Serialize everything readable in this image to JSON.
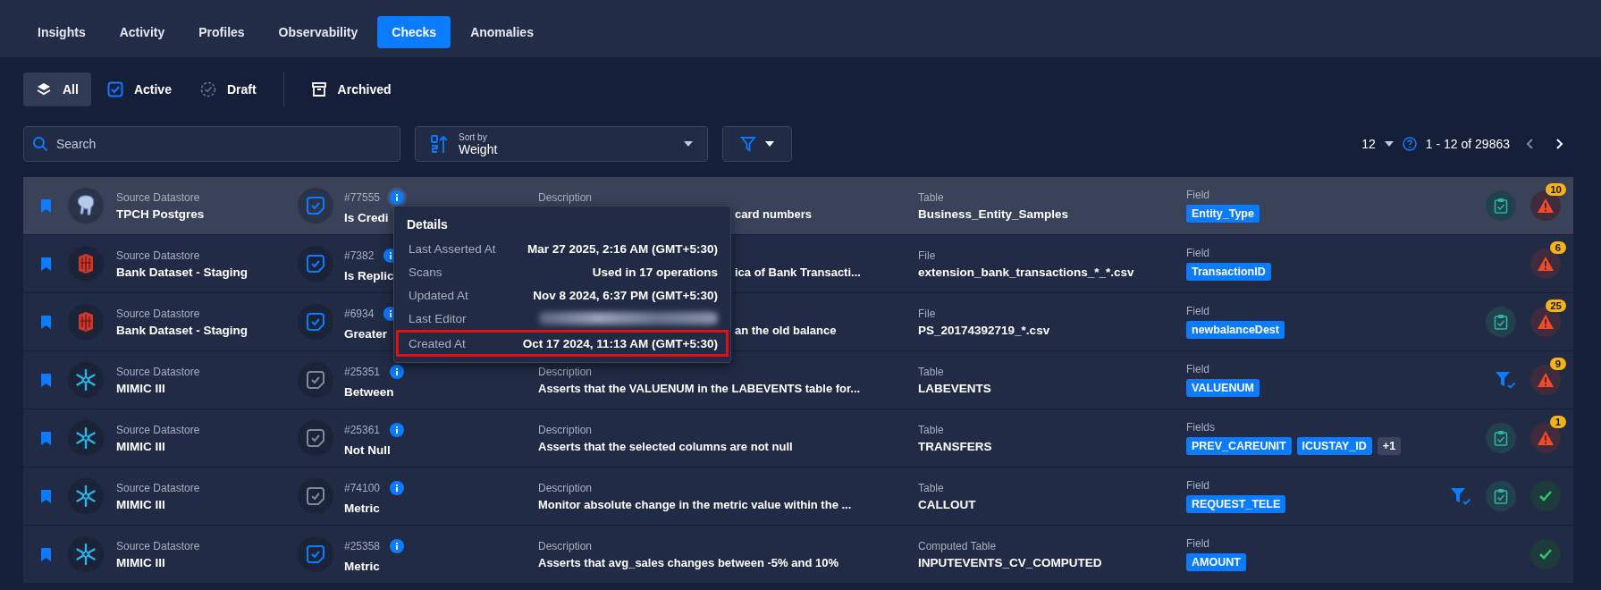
{
  "tabs": [
    {
      "label": "Insights",
      "selected": false
    },
    {
      "label": "Activity",
      "selected": false
    },
    {
      "label": "Profiles",
      "selected": false
    },
    {
      "label": "Observability",
      "selected": false
    },
    {
      "label": "Checks",
      "selected": true
    },
    {
      "label": "Anomalies",
      "selected": false
    }
  ],
  "status_filters": [
    {
      "kind": "all",
      "label": "All",
      "selected": true
    },
    {
      "kind": "active",
      "label": "Active",
      "selected": false
    },
    {
      "kind": "draft",
      "label": "Draft",
      "selected": false
    },
    {
      "kind": "archived",
      "label": "Archived",
      "selected": false
    }
  ],
  "search": {
    "placeholder": "Search"
  },
  "sort": {
    "label": "Sort by",
    "value": "Weight"
  },
  "pagination": {
    "page_size": "12",
    "range": "1 - 12 of 29863",
    "prev_disabled": true
  },
  "rows": [
    {
      "highlighted": true,
      "datastore": {
        "kind": "postgres",
        "label": "Source Datastore",
        "name": "TPCH Postgres"
      },
      "active": true,
      "id": "#77555",
      "name": "Is Credi",
      "info_hovered": true,
      "description_label": "Description",
      "description": "card numbers",
      "container_label": "Table",
      "container": "Business_Entity_Samples",
      "field_label": "Field",
      "fields": [
        "Entity_Type"
      ],
      "filter_badge": false,
      "clipboard_badge": true,
      "status": {
        "kind": "anomalies",
        "count": "10"
      }
    },
    {
      "highlighted": false,
      "datastore": {
        "kind": "bucket",
        "label": "Source Datastore",
        "name": "Bank Dataset - Staging"
      },
      "active": true,
      "id": "#7382",
      "name": "Is Replic",
      "info_hovered": false,
      "description": "ica of Bank Transacti...",
      "container_label": "File",
      "container": "extension_bank_transactions_*_*.csv",
      "field_label": "Field",
      "fields": [
        "TransactionID"
      ],
      "filter_badge": false,
      "clipboard_badge": false,
      "status": {
        "kind": "anomalies",
        "count": "6"
      }
    },
    {
      "highlighted": false,
      "datastore": {
        "kind": "bucket",
        "label": "Source Datastore",
        "name": "Bank Dataset - Staging"
      },
      "active": true,
      "id": "#6934",
      "name": "Greater",
      "info_hovered": false,
      "description": "an the old balance",
      "container_label": "File",
      "container": "PS_20174392719_*.csv",
      "field_label": "Field",
      "fields": [
        "newbalanceDest"
      ],
      "filter_badge": false,
      "clipboard_badge": true,
      "status": {
        "kind": "anomalies",
        "count": "25"
      }
    },
    {
      "highlighted": false,
      "datastore": {
        "kind": "snowflake",
        "label": "Source Datastore",
        "name": "MIMIC III"
      },
      "active": false,
      "id": "#25351",
      "name": "Between",
      "info_hovered": false,
      "description_label": "Description",
      "description": "Asserts that the VALUENUM in the LABEVENTS table for...",
      "container_label": "Table",
      "container": "LABEVENTS",
      "field_label": "Field",
      "fields": [
        "VALUENUM"
      ],
      "filter_badge": true,
      "clipboard_badge": false,
      "status": {
        "kind": "anomalies",
        "count": "9"
      }
    },
    {
      "highlighted": false,
      "datastore": {
        "kind": "snowflake",
        "label": "Source Datastore",
        "name": "MIMIC III"
      },
      "active": false,
      "id": "#25361",
      "name": "Not Null",
      "info_hovered": false,
      "description_label": "Description",
      "description": "Asserts that the selected columns are not null",
      "container_label": "Table",
      "container": "TRANSFERS",
      "field_label": "Fields",
      "fields": [
        "PREV_CAREUNIT",
        "ICUSTAY_ID"
      ],
      "more_fields": "+1",
      "filter_badge": false,
      "clipboard_badge": true,
      "status": {
        "kind": "anomalies",
        "count": "1"
      }
    },
    {
      "highlighted": false,
      "datastore": {
        "kind": "snowflake",
        "label": "Source Datastore",
        "name": "MIMIC III"
      },
      "active": false,
      "id": "#74100",
      "name": "Metric",
      "info_hovered": false,
      "description_label": "Description",
      "description": "Monitor absolute change in the metric value within the ...",
      "container_label": "Table",
      "container": "CALLOUT",
      "field_label": "Field",
      "fields": [
        "REQUEST_TELE"
      ],
      "filter_badge": true,
      "clipboard_badge": true,
      "status": {
        "kind": "passed"
      }
    },
    {
      "highlighted": false,
      "datastore": {
        "kind": "snowflake",
        "label": "Source Datastore",
        "name": "MIMIC III"
      },
      "active": true,
      "id": "#25358",
      "name": "Metric",
      "info_hovered": false,
      "description_label": "Description",
      "description": "Asserts that avg_sales changes between -5% and 10%",
      "container_label": "Computed Table",
      "container": "INPUTEVENTS_CV_COMPUTED",
      "field_label": "Field",
      "fields": [
        "AMOUNT"
      ],
      "filter_badge": false,
      "clipboard_badge": false,
      "status": {
        "kind": "passed"
      }
    }
  ],
  "details_popup": {
    "title": "Details",
    "items": [
      {
        "label": "Last Asserted At",
        "value": "Mar 27 2025, 2:16 AM (GMT+5:30)",
        "highlighted": false
      },
      {
        "label": "Scans",
        "value": "Used in 17 operations",
        "highlighted": false
      },
      {
        "label": "Updated At",
        "value": "Nov 8 2024, 6:37 PM (GMT+5:30)",
        "highlighted": false
      },
      {
        "label": "Last Editor",
        "redacted": true,
        "highlighted": false
      },
      {
        "label": "Created At",
        "value": "Oct 17 2024, 11:13 AM (GMT+5:30)",
        "highlighted": true
      }
    ]
  }
}
